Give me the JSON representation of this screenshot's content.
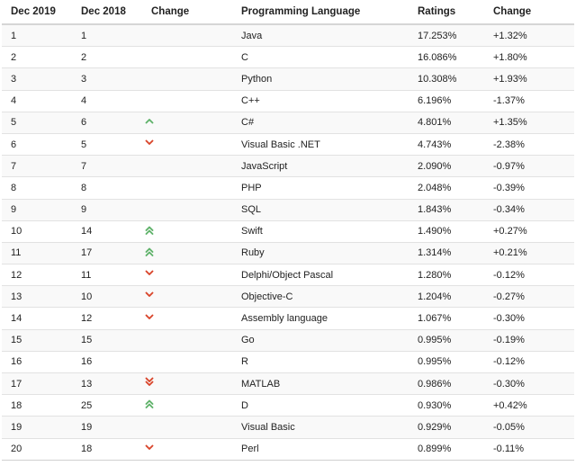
{
  "headers": {
    "dec2019": "Dec 2019",
    "dec2018": "Dec 2018",
    "change": "Change",
    "language": "Programming Language",
    "ratings": "Ratings",
    "change_pct": "Change"
  },
  "colors": {
    "up": "#5fb26a",
    "down": "#d9452b"
  },
  "rows": [
    {
      "dec2019": "1",
      "dec2018": "1",
      "trend": "none",
      "language": "Java",
      "ratings": "17.253%",
      "change": "+1.32%"
    },
    {
      "dec2019": "2",
      "dec2018": "2",
      "trend": "none",
      "language": "C",
      "ratings": "16.086%",
      "change": "+1.80%"
    },
    {
      "dec2019": "3",
      "dec2018": "3",
      "trend": "none",
      "language": "Python",
      "ratings": "10.308%",
      "change": "+1.93%"
    },
    {
      "dec2019": "4",
      "dec2018": "4",
      "trend": "none",
      "language": "C++",
      "ratings": "6.196%",
      "change": "-1.37%"
    },
    {
      "dec2019": "5",
      "dec2018": "6",
      "trend": "up",
      "language": "C#",
      "ratings": "4.801%",
      "change": "+1.35%"
    },
    {
      "dec2019": "6",
      "dec2018": "5",
      "trend": "down",
      "language": "Visual Basic .NET",
      "ratings": "4.743%",
      "change": "-2.38%"
    },
    {
      "dec2019": "7",
      "dec2018": "7",
      "trend": "none",
      "language": "JavaScript",
      "ratings": "2.090%",
      "change": "-0.97%"
    },
    {
      "dec2019": "8",
      "dec2018": "8",
      "trend": "none",
      "language": "PHP",
      "ratings": "2.048%",
      "change": "-0.39%"
    },
    {
      "dec2019": "9",
      "dec2018": "9",
      "trend": "none",
      "language": "SQL",
      "ratings": "1.843%",
      "change": "-0.34%"
    },
    {
      "dec2019": "10",
      "dec2018": "14",
      "trend": "double-up",
      "language": "Swift",
      "ratings": "1.490%",
      "change": "+0.27%"
    },
    {
      "dec2019": "11",
      "dec2018": "17",
      "trend": "double-up",
      "language": "Ruby",
      "ratings": "1.314%",
      "change": "+0.21%"
    },
    {
      "dec2019": "12",
      "dec2018": "11",
      "trend": "down",
      "language": "Delphi/Object Pascal",
      "ratings": "1.280%",
      "change": "-0.12%"
    },
    {
      "dec2019": "13",
      "dec2018": "10",
      "trend": "down",
      "language": "Objective-C",
      "ratings": "1.204%",
      "change": "-0.27%"
    },
    {
      "dec2019": "14",
      "dec2018": "12",
      "trend": "down",
      "language": "Assembly language",
      "ratings": "1.067%",
      "change": "-0.30%"
    },
    {
      "dec2019": "15",
      "dec2018": "15",
      "trend": "none",
      "language": "Go",
      "ratings": "0.995%",
      "change": "-0.19%"
    },
    {
      "dec2019": "16",
      "dec2018": "16",
      "trend": "none",
      "language": "R",
      "ratings": "0.995%",
      "change": "-0.12%"
    },
    {
      "dec2019": "17",
      "dec2018": "13",
      "trend": "double-down",
      "language": "MATLAB",
      "ratings": "0.986%",
      "change": "-0.30%"
    },
    {
      "dec2019": "18",
      "dec2018": "25",
      "trend": "double-up",
      "language": "D",
      "ratings": "0.930%",
      "change": "+0.42%"
    },
    {
      "dec2019": "19",
      "dec2018": "19",
      "trend": "none",
      "language": "Visual Basic",
      "ratings": "0.929%",
      "change": "-0.05%"
    },
    {
      "dec2019": "20",
      "dec2018": "18",
      "trend": "down",
      "language": "Perl",
      "ratings": "0.899%",
      "change": "-0.11%"
    }
  ]
}
